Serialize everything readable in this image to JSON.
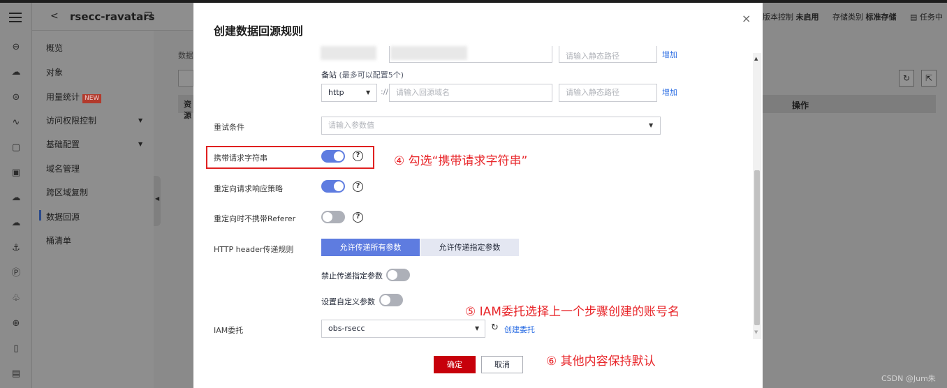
{
  "app": {
    "bucket_name": "rsecc-ravatars",
    "nav_items": [
      "概览",
      "对象",
      "用量统计",
      "访问权限控制",
      "基础配置",
      "域名管理",
      "跨区域复制",
      "数据回源",
      "桶清单"
    ],
    "new_badge": "NEW",
    "main_left_text": "数据",
    "main_left_th": "资源",
    "right_info": {
      "versioning_label": "版本控制",
      "versioning_value": "未启用",
      "storage_class_label": "存储类别",
      "storage_class_value": "标准存储",
      "tasks_label": "任务中"
    },
    "ops_header": "操作",
    "watermark": "CSDN @Jum朱"
  },
  "dialog": {
    "title": "创建数据回源规则",
    "close_glyph": "×",
    "top_path_placeholder": "请输入静态路径",
    "top_add_link": "增加",
    "backup_label": "备站",
    "backup_hint": "(最多可以配置5个)",
    "protocol_value": "http",
    "protocol_sep": "://",
    "domain_placeholder": "请输入回源域名",
    "path_placeholder": "请输入静态路径",
    "add_link": "增加",
    "retry_label": "重试条件",
    "retry_placeholder": "请输入参数值",
    "carry_query_label": "携带请求字符串",
    "carry_query_on": true,
    "redirect_policy_label": "重定向请求响应策略",
    "redirect_policy_on": true,
    "redirect_no_referer_label": "重定向时不携带Referer",
    "redirect_no_referer_on": false,
    "http_header_label": "HTTP header传递规则",
    "seg_all_label": "允许传递所有参数",
    "seg_specified_label": "允许传递指定参数",
    "forbid_params_label": "禁止传递指定参数",
    "forbid_params_on": false,
    "custom_params_label": "设置自定义参数",
    "custom_params_on": false,
    "iam_label": "IAM委托",
    "iam_value": "obs-rsecc",
    "create_delegation_link": "创建委托",
    "confirm_label": "确定",
    "cancel_label": "取消",
    "help_glyph": "?"
  },
  "annotations": {
    "step4": "④ 勾选“携带请求字符串”",
    "step5": "⑤ IAM委托选择上一个步骤创建的账号名",
    "step6": "⑥ 其他内容保持默认"
  },
  "colors": {
    "accent": "#5e7ce0",
    "primary_button": "#c7000b",
    "annotation_red": "#e8262a",
    "link_blue": "#2b6de3"
  }
}
